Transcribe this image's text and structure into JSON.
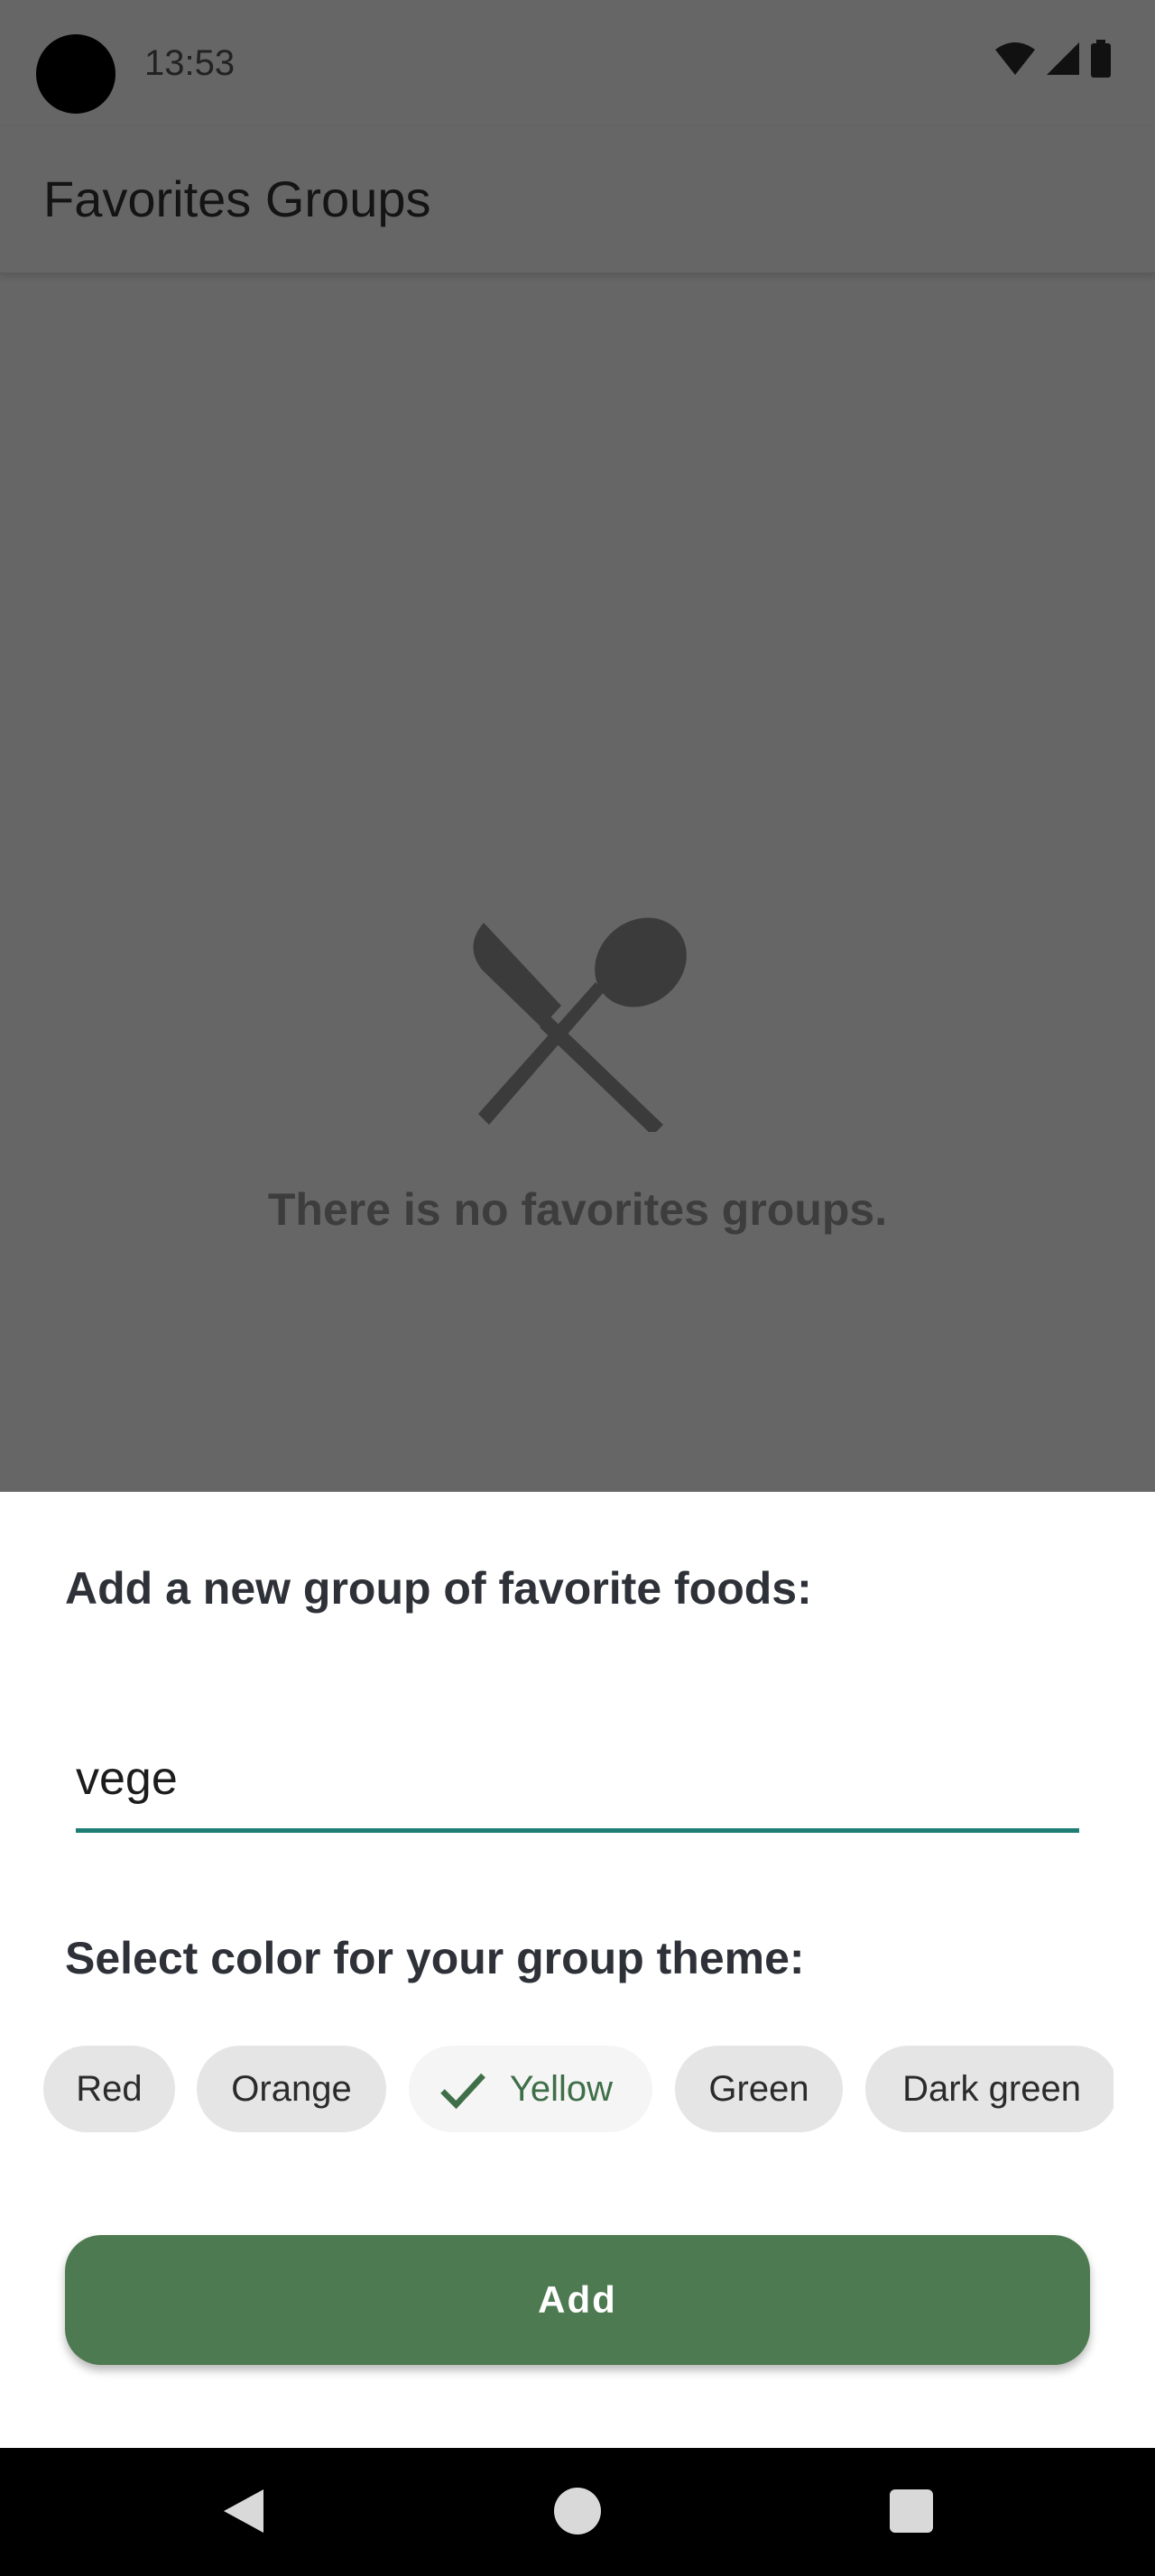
{
  "status_bar": {
    "time": "13:53",
    "icons": [
      "wifi-icon",
      "signal-icon",
      "battery-icon"
    ]
  },
  "app_bar": {
    "title": "Favorites Groups"
  },
  "empty_state": {
    "icon": "cutlery-icon",
    "message": "There is no favorites groups."
  },
  "sheet": {
    "title": "Add a new group of favorite foods:",
    "group_name_value": "vege",
    "color_title": "Select color for your group theme:",
    "colors": [
      {
        "label": "Red",
        "selected": false
      },
      {
        "label": "Orange",
        "selected": false
      },
      {
        "label": "Yellow",
        "selected": true
      },
      {
        "label": "Green",
        "selected": false
      },
      {
        "label": "Dark green",
        "selected": false
      }
    ],
    "add_label": "Add"
  },
  "nav_bar": {
    "buttons": [
      "back-icon",
      "home-icon",
      "recents-icon"
    ]
  },
  "theme": {
    "accent": "#4e7a51",
    "input_underline": "#1d7d72",
    "selected_chip_text": "#3f6f48",
    "scrim": "#666666"
  }
}
